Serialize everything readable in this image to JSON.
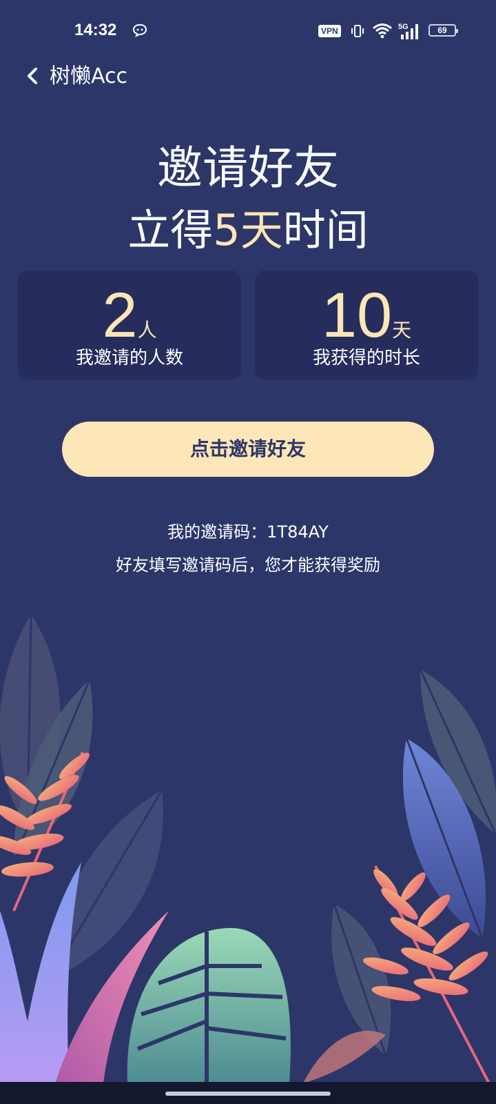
{
  "status_bar": {
    "time": "14:32",
    "vpn": "VPN",
    "network": "5G",
    "battery": "69",
    "icons": [
      "message-icon",
      "vibrate-icon",
      "wifi-icon",
      "signal-icon",
      "battery-icon"
    ]
  },
  "header": {
    "back_icon": "chevron-left-icon",
    "title": "树懒Acc"
  },
  "hero": {
    "line1": "邀请好友",
    "line2_prefix": "立得",
    "line2_accent": "5天",
    "line2_suffix": "时间"
  },
  "stats": {
    "invited": {
      "value": "2",
      "unit": "人",
      "label": "我邀请的人数"
    },
    "earned": {
      "value": "10",
      "unit": "天",
      "label": "我获得的时长"
    }
  },
  "invite_button": {
    "label": "点击邀请好友"
  },
  "invite_code": {
    "prefix": "我的邀请码：",
    "code": "1T84AY",
    "hint": "好友填写邀请码后，您才能获得奖励"
  },
  "colors": {
    "background": "#2d3669",
    "card": "#262d5c",
    "accent": "#fde6b6",
    "button": "#fde6b8"
  }
}
